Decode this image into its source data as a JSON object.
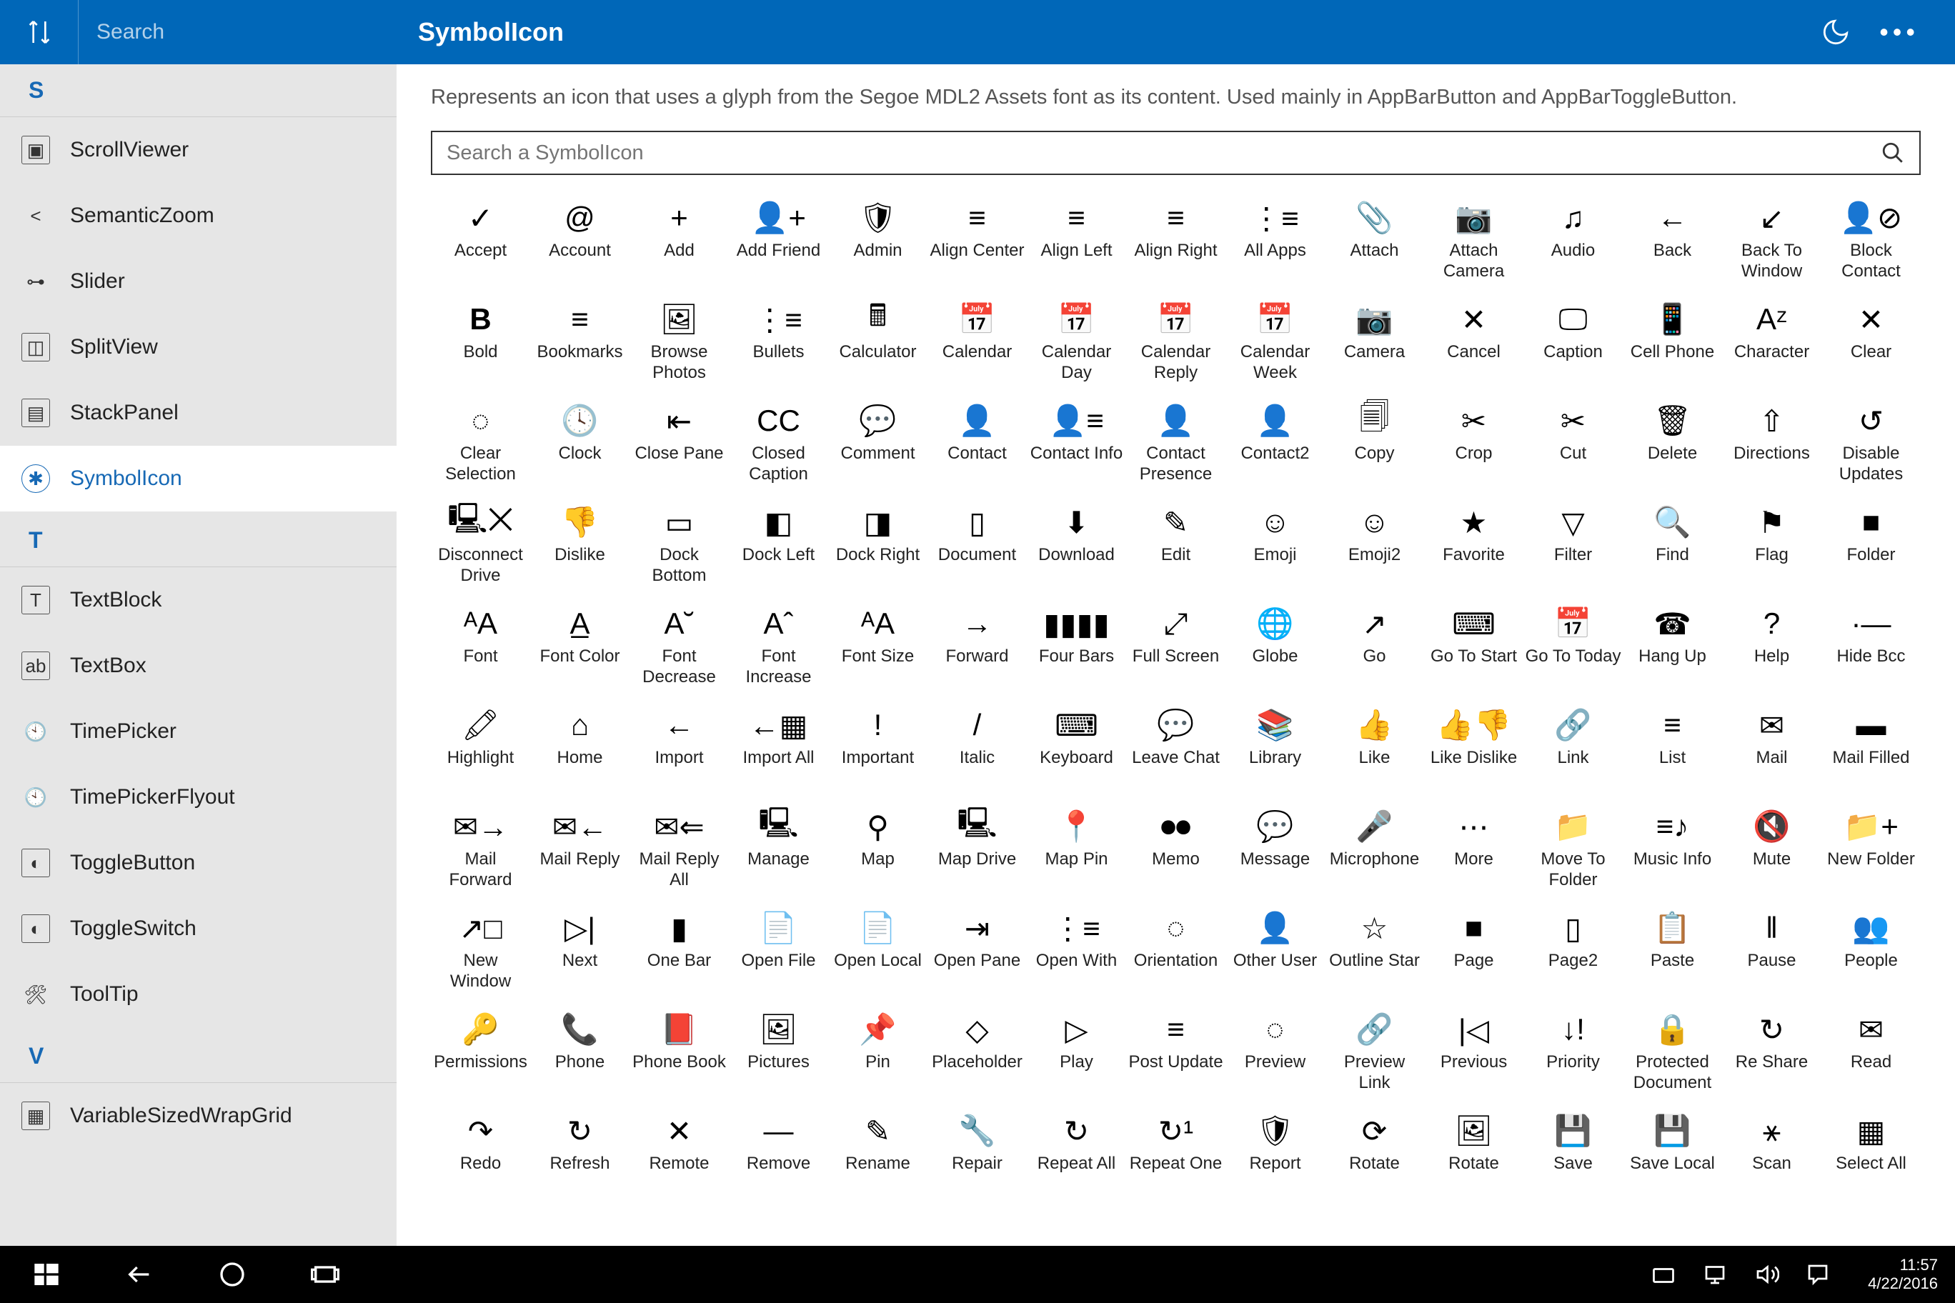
{
  "titlebar": {
    "search_placeholder": "Search",
    "title": "SymbolIcon"
  },
  "sidebar": {
    "groups": [
      {
        "letter": "S",
        "items": [
          {
            "name": "scrollviewer",
            "label": "ScrollViewer",
            "icon": "▣"
          },
          {
            "name": "semanticzoom",
            "label": "SemanticZoom",
            "icon": "< >"
          },
          {
            "name": "slider",
            "label": "Slider",
            "icon": "⊶"
          },
          {
            "name": "splitview",
            "label": "SplitView",
            "icon": "◫"
          },
          {
            "name": "stackpanel",
            "label": "StackPanel",
            "icon": "▤"
          },
          {
            "name": "symbolicon",
            "label": "SymbolIcon",
            "icon": "✱",
            "selected": true
          }
        ]
      },
      {
        "letter": "T",
        "items": [
          {
            "name": "textblock",
            "label": "TextBlock",
            "icon": "T"
          },
          {
            "name": "textbox",
            "label": "TextBox",
            "icon": "abI"
          },
          {
            "name": "timepicker",
            "label": "TimePicker",
            "icon": "🕙"
          },
          {
            "name": "timepickerflyout",
            "label": "TimePickerFlyout",
            "icon": "🕙"
          },
          {
            "name": "togglebutton",
            "label": "ToggleButton",
            "icon": "◐"
          },
          {
            "name": "toggleswitch",
            "label": "ToggleSwitch",
            "icon": "◐"
          },
          {
            "name": "tooltip",
            "label": "ToolTip",
            "icon": "🛠"
          }
        ]
      },
      {
        "letter": "V",
        "items": [
          {
            "name": "variablesizedwrapgrid",
            "label": "VariableSizedWrapGrid",
            "icon": "▦"
          }
        ]
      }
    ]
  },
  "main": {
    "description": "Represents an icon that uses a glyph from the Segoe MDL2 Assets font as its content. Used mainly in AppBarButton and AppBarToggleButton.",
    "search_placeholder": "Search a SymbolIcon",
    "icons": [
      {
        "label": "Accept",
        "g": "✓"
      },
      {
        "label": "Account",
        "g": "@"
      },
      {
        "label": "Add",
        "g": "+"
      },
      {
        "label": "Add Friend",
        "g": "👤+"
      },
      {
        "label": "Admin",
        "g": "🛡"
      },
      {
        "label": "Align Center",
        "g": "≡"
      },
      {
        "label": "Align Left",
        "g": "≡"
      },
      {
        "label": "Align Right",
        "g": "≡"
      },
      {
        "label": "All Apps",
        "g": "⋮≡"
      },
      {
        "label": "Attach",
        "g": "📎"
      },
      {
        "label": "Attach Camera",
        "g": "📷"
      },
      {
        "label": "Audio",
        "g": "♫"
      },
      {
        "label": "Back",
        "g": "←"
      },
      {
        "label": "Back To Window",
        "g": "↙"
      },
      {
        "label": "Block Contact",
        "g": "👤⊘"
      },
      {
        "label": "Bold",
        "g": "B"
      },
      {
        "label": "Bookmarks",
        "g": "≡"
      },
      {
        "label": "Browse Photos",
        "g": "🖼"
      },
      {
        "label": "Bullets",
        "g": "⋮≡"
      },
      {
        "label": "Calculator",
        "g": "🖩"
      },
      {
        "label": "Calendar",
        "g": "📅"
      },
      {
        "label": "Calendar Day",
        "g": "📅"
      },
      {
        "label": "Calendar Reply",
        "g": "📅"
      },
      {
        "label": "Calendar Week",
        "g": "📅"
      },
      {
        "label": "Camera",
        "g": "📷"
      },
      {
        "label": "Cancel",
        "g": "✕"
      },
      {
        "label": "Caption",
        "g": "🖵"
      },
      {
        "label": "Cell Phone",
        "g": "📱"
      },
      {
        "label": "Character",
        "g": "Aᶻ"
      },
      {
        "label": "Clear",
        "g": "✕"
      },
      {
        "label": "Clear Selection",
        "g": "◌"
      },
      {
        "label": "Clock",
        "g": "🕓"
      },
      {
        "label": "Close Pane",
        "g": "⇤"
      },
      {
        "label": "Closed Caption",
        "g": "CC"
      },
      {
        "label": "Comment",
        "g": "💬"
      },
      {
        "label": "Contact",
        "g": "👤"
      },
      {
        "label": "Contact Info",
        "g": "👤≡"
      },
      {
        "label": "Contact Presence",
        "g": "👤"
      },
      {
        "label": "Contact2",
        "g": "👤"
      },
      {
        "label": "Copy",
        "g": "🗐"
      },
      {
        "label": "Crop",
        "g": "✂"
      },
      {
        "label": "Cut",
        "g": "✂"
      },
      {
        "label": "Delete",
        "g": "🗑"
      },
      {
        "label": "Directions",
        "g": "⇧"
      },
      {
        "label": "Disable Updates",
        "g": "↺"
      },
      {
        "label": "Disconnect Drive",
        "g": "🖳✕"
      },
      {
        "label": "Dislike",
        "g": "👎"
      },
      {
        "label": "Dock Bottom",
        "g": "▭"
      },
      {
        "label": "Dock Left",
        "g": "◧"
      },
      {
        "label": "Dock Right",
        "g": "◨"
      },
      {
        "label": "Document",
        "g": "▯"
      },
      {
        "label": "Download",
        "g": "⬇"
      },
      {
        "label": "Edit",
        "g": "✎"
      },
      {
        "label": "Emoji",
        "g": "☺"
      },
      {
        "label": "Emoji2",
        "g": "☺"
      },
      {
        "label": "Favorite",
        "g": "★"
      },
      {
        "label": "Filter",
        "g": "▽"
      },
      {
        "label": "Find",
        "g": "🔍"
      },
      {
        "label": "Flag",
        "g": "⚑"
      },
      {
        "label": "Folder",
        "g": "■"
      },
      {
        "label": "Font",
        "g": "ᴬA"
      },
      {
        "label": "Font Color",
        "g": "A̲"
      },
      {
        "label": "Font Decrease",
        "g": "A˘"
      },
      {
        "label": "Font Increase",
        "g": "Aˆ"
      },
      {
        "label": "Font Size",
        "g": "ᴬA"
      },
      {
        "label": "Forward",
        "g": "→"
      },
      {
        "label": "Four Bars",
        "g": "▮▮▮▮"
      },
      {
        "label": "Full Screen",
        "g": "⤢"
      },
      {
        "label": "Globe",
        "g": "🌐"
      },
      {
        "label": "Go",
        "g": "↗"
      },
      {
        "label": "Go To Start",
        "g": "⌨"
      },
      {
        "label": "Go To Today",
        "g": "📅"
      },
      {
        "label": "Hang Up",
        "g": "☎"
      },
      {
        "label": "Help",
        "g": "?"
      },
      {
        "label": "Hide Bcc",
        "g": "·—"
      },
      {
        "label": "Highlight",
        "g": "🖍"
      },
      {
        "label": "Home",
        "g": "⌂"
      },
      {
        "label": "Import",
        "g": "←"
      },
      {
        "label": "Import All",
        "g": "←▦"
      },
      {
        "label": "Important",
        "g": "!"
      },
      {
        "label": "Italic",
        "g": "/"
      },
      {
        "label": "Keyboard",
        "g": "⌨"
      },
      {
        "label": "Leave Chat",
        "g": "💬"
      },
      {
        "label": "Library",
        "g": "📚"
      },
      {
        "label": "Like",
        "g": "👍"
      },
      {
        "label": "Like Dislike",
        "g": "👍👎"
      },
      {
        "label": "Link",
        "g": "🔗"
      },
      {
        "label": "List",
        "g": "≡"
      },
      {
        "label": "Mail",
        "g": "✉"
      },
      {
        "label": "Mail Filled",
        "g": "▬"
      },
      {
        "label": "Mail Forward",
        "g": "✉→"
      },
      {
        "label": "Mail Reply",
        "g": "✉←"
      },
      {
        "label": "Mail Reply All",
        "g": "✉⇐"
      },
      {
        "label": "Manage",
        "g": "🖳"
      },
      {
        "label": "Map",
        "g": "⚲"
      },
      {
        "label": "Map Drive",
        "g": "🖳"
      },
      {
        "label": "Map Pin",
        "g": "📍"
      },
      {
        "label": "Memo",
        "g": "⏺⏺"
      },
      {
        "label": "Message",
        "g": "💬"
      },
      {
        "label": "Microphone",
        "g": "🎤"
      },
      {
        "label": "More",
        "g": "⋯"
      },
      {
        "label": "Move To Folder",
        "g": "📁"
      },
      {
        "label": "Music Info",
        "g": "≡♪"
      },
      {
        "label": "Mute",
        "g": "🔇"
      },
      {
        "label": "New Folder",
        "g": "📁+"
      },
      {
        "label": "New Window",
        "g": "↗□"
      },
      {
        "label": "Next",
        "g": "▷|"
      },
      {
        "label": "One Bar",
        "g": "▮"
      },
      {
        "label": "Open File",
        "g": "📄"
      },
      {
        "label": "Open Local",
        "g": "📄"
      },
      {
        "label": "Open Pane",
        "g": "⇥"
      },
      {
        "label": "Open With",
        "g": "⋮≡"
      },
      {
        "label": "Orientation",
        "g": "◌"
      },
      {
        "label": "Other User",
        "g": "👤"
      },
      {
        "label": "Outline Star",
        "g": "☆"
      },
      {
        "label": "Page",
        "g": "■"
      },
      {
        "label": "Page2",
        "g": "▯"
      },
      {
        "label": "Paste",
        "g": "📋"
      },
      {
        "label": "Pause",
        "g": "‖"
      },
      {
        "label": "People",
        "g": "👥"
      },
      {
        "label": "Permissions",
        "g": "🔑"
      },
      {
        "label": "Phone",
        "g": "📞"
      },
      {
        "label": "Phone Book",
        "g": "📕"
      },
      {
        "label": "Pictures",
        "g": "🖼"
      },
      {
        "label": "Pin",
        "g": "📌"
      },
      {
        "label": "Placeholder",
        "g": "◇"
      },
      {
        "label": "Play",
        "g": "▷"
      },
      {
        "label": "Post Update",
        "g": "≡"
      },
      {
        "label": "Preview",
        "g": "◌"
      },
      {
        "label": "Preview Link",
        "g": "🔗"
      },
      {
        "label": "Previous",
        "g": "|◁"
      },
      {
        "label": "Priority",
        "g": "↓!"
      },
      {
        "label": "Protected Document",
        "g": "🔒"
      },
      {
        "label": "Re Share",
        "g": "↻"
      },
      {
        "label": "Read",
        "g": "✉"
      },
      {
        "label": "Redo",
        "g": "↷"
      },
      {
        "label": "Refresh",
        "g": "↻"
      },
      {
        "label": "Remote",
        "g": "✕"
      },
      {
        "label": "Remove",
        "g": "—"
      },
      {
        "label": "Rename",
        "g": "✎"
      },
      {
        "label": "Repair",
        "g": "🔧"
      },
      {
        "label": "Repeat All",
        "g": "↻"
      },
      {
        "label": "Repeat One",
        "g": "↻¹"
      },
      {
        "label": "Report",
        "g": "🛡"
      },
      {
        "label": "Rotate",
        "g": "⟳"
      },
      {
        "label": "Rotate",
        "g": "🖼"
      },
      {
        "label": "Save",
        "g": "💾"
      },
      {
        "label": "Save Local",
        "g": "💾"
      },
      {
        "label": "Scan",
        "g": "⚹"
      },
      {
        "label": "Select All",
        "g": "▦"
      }
    ]
  },
  "taskbar": {
    "time": "11:57",
    "date": "4/22/2016"
  }
}
